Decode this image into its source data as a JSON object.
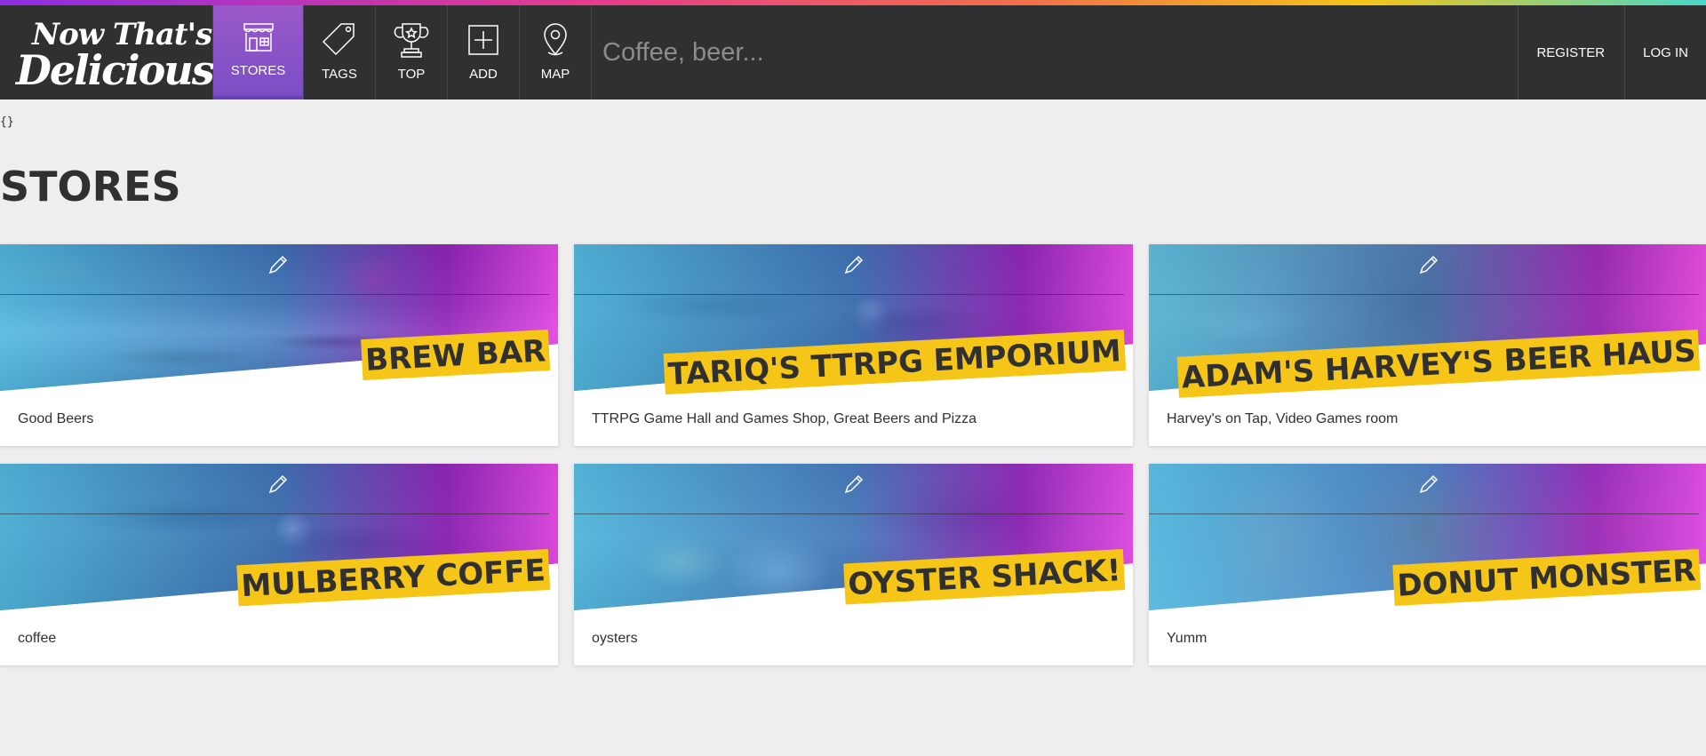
{
  "brand": {
    "line1": "Now That's",
    "line2": "Delicious!"
  },
  "nav": [
    {
      "label": "STORES",
      "icon": "store-icon",
      "active": true
    },
    {
      "label": "TAGS",
      "icon": "tag-icon"
    },
    {
      "label": "TOP",
      "icon": "trophy-icon"
    },
    {
      "label": "ADD",
      "icon": "add-icon"
    },
    {
      "label": "MAP",
      "icon": "map-pin-icon"
    }
  ],
  "search": {
    "placeholder": "Coffee, beer..."
  },
  "auth": {
    "register": "REGISTER",
    "login": "LOG IN"
  },
  "debug": "{}",
  "page_title": "STORES",
  "stores": [
    {
      "name": "BREW BAR",
      "description": "Good Beers",
      "scene": "pastry-counter"
    },
    {
      "name": "TARIQ'S TTRPG EMPORIUM",
      "description": "TTRPG Game Hall and Games Shop, Great Beers and Pizza",
      "scene": "cafe-tables"
    },
    {
      "name": "ADAM'S HARVEY'S BEER HAUS",
      "description": "Harvey's on Tap, Video Games room",
      "scene": "bread-board"
    },
    {
      "name": "MULBERRY COFFE",
      "description": "coffee",
      "scene": "cafe-tables"
    },
    {
      "name": "OYSTER SHACK!",
      "description": "oysters",
      "scene": "oysters"
    },
    {
      "name": "DONUT MONSTER",
      "description": "Yumm",
      "scene": "donut"
    }
  ],
  "colors": {
    "nav_bg": "#303030",
    "active_nav": "#7a4fc4",
    "title_highlight": "#f5c518",
    "page_bg": "#eeeeee"
  }
}
